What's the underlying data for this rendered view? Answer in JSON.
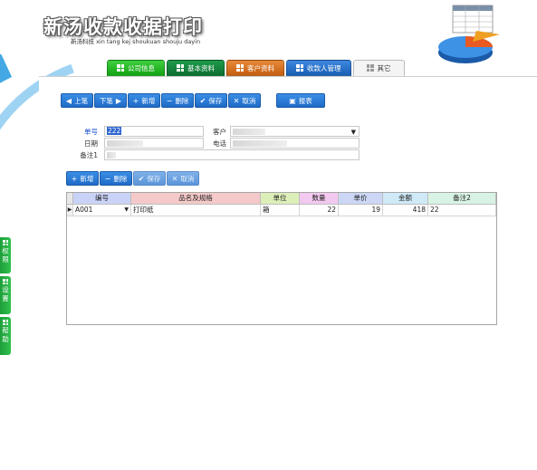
{
  "app": {
    "title": "新汤收款收据打印",
    "subtitle": "新汤科技 xin tang kej shoukuan shouju dayin"
  },
  "tabs": [
    {
      "label": "公司信息",
      "color": "#18a818"
    },
    {
      "label": "基本资料",
      "color": "#127a38"
    },
    {
      "label": "客户资料",
      "color": "#d06a18"
    },
    {
      "label": "收款人管理",
      "color": "#2068c0"
    },
    {
      "label": "其它",
      "color": "#f4f4f4"
    }
  ],
  "toolbar": {
    "prev": "上笔",
    "next": "下笔",
    "add": "新增",
    "delete": "删除",
    "save": "保存",
    "cancel": "取消",
    "report": "报表"
  },
  "form": {
    "doc_no_label": "单号",
    "doc_no_value": "222",
    "date_label": "日期",
    "customer_label": "客户",
    "phone_label": "电话",
    "remark_label": "备注1"
  },
  "detail_toolbar": {
    "add": "新增",
    "delete": "删除",
    "save": "保存",
    "cancel": "取消"
  },
  "grid": {
    "columns": [
      {
        "label": "编号",
        "color": "#c9d3f7"
      },
      {
        "label": "品名及规格",
        "color": "#f5c9c9"
      },
      {
        "label": "单位",
        "color": "#dcefb8"
      },
      {
        "label": "数量",
        "color": "#f3c9f0"
      },
      {
        "label": "单价",
        "color": "#cbd7f5"
      },
      {
        "label": "金额",
        "color": "#cfe9f7"
      },
      {
        "label": "备注2",
        "color": "#d8f3e3"
      }
    ],
    "rows": [
      {
        "code": "A001",
        "name": "打印纸",
        "unit": "箱",
        "qty": "22",
        "price": "19",
        "amount": "418",
        "remark": "22"
      }
    ]
  },
  "side_tabs": [
    {
      "label": "权限"
    },
    {
      "label": "设置"
    },
    {
      "label": "帮助"
    }
  ]
}
